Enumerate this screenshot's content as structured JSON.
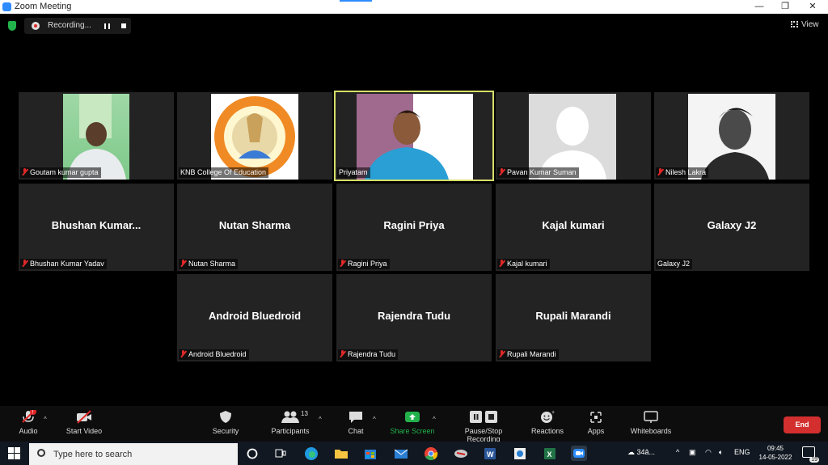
{
  "window": {
    "title": "Zoom Meeting"
  },
  "window_controls": {
    "minimize": "—",
    "maximize": "❐",
    "close": "✕"
  },
  "recording": {
    "label": "Recording..."
  },
  "view_button": {
    "label": "View"
  },
  "participants_grid": [
    {
      "name": "Goutam kumar gupta",
      "muted": true,
      "has_video": true
    },
    {
      "name": "KNB College Of Education",
      "muted": false,
      "has_video": true
    },
    {
      "name": "Priyatam",
      "muted": false,
      "has_video": true,
      "speaking": true
    },
    {
      "name": "Pavan Kumar Suman",
      "muted": true,
      "has_video": true
    },
    {
      "name": "Nilesh Lakra",
      "muted": true,
      "has_video": true
    },
    {
      "display": "Bhushan  Kumar...",
      "name": "Bhushan Kumar Yadav",
      "muted": true
    },
    {
      "display": "Nutan Sharma",
      "name": "Nutan Sharma",
      "muted": true
    },
    {
      "display": "Ragini Priya",
      "name": "Ragini Priya",
      "muted": true
    },
    {
      "display": "Kajal kumari",
      "name": "Kajal kumari",
      "muted": true
    },
    {
      "display": "Galaxy J2",
      "name": "Galaxy J2",
      "muted": false
    },
    {
      "display": "Android Bluedroid",
      "name": "Android Bluedroid",
      "muted": true
    },
    {
      "display": "Rajendra Tudu",
      "name": "Rajendra Tudu",
      "muted": true
    },
    {
      "display": "Rupali Marandi",
      "name": "Rupali Marandi",
      "muted": true
    }
  ],
  "toolbar": {
    "audio": "Audio",
    "start_video": "Start Video",
    "security": "Security",
    "participants": "Participants",
    "participants_count": "13",
    "chat": "Chat",
    "share_screen": "Share Screen",
    "pause_stop_recording": "Pause/Stop Recording",
    "reactions": "Reactions",
    "apps": "Apps",
    "whiteboards": "Whiteboards",
    "end": "End"
  },
  "taskbar": {
    "search_placeholder": "Type here to search",
    "weather": "34â...",
    "language": "ENG",
    "time": "09:45",
    "date": "14-05-2022",
    "notifications": "19"
  },
  "colors": {
    "zoom_blue": "#2d8cff",
    "active_speaker": "#d7df68",
    "end_red": "#d32f2f",
    "share_green": "#22b24c"
  }
}
